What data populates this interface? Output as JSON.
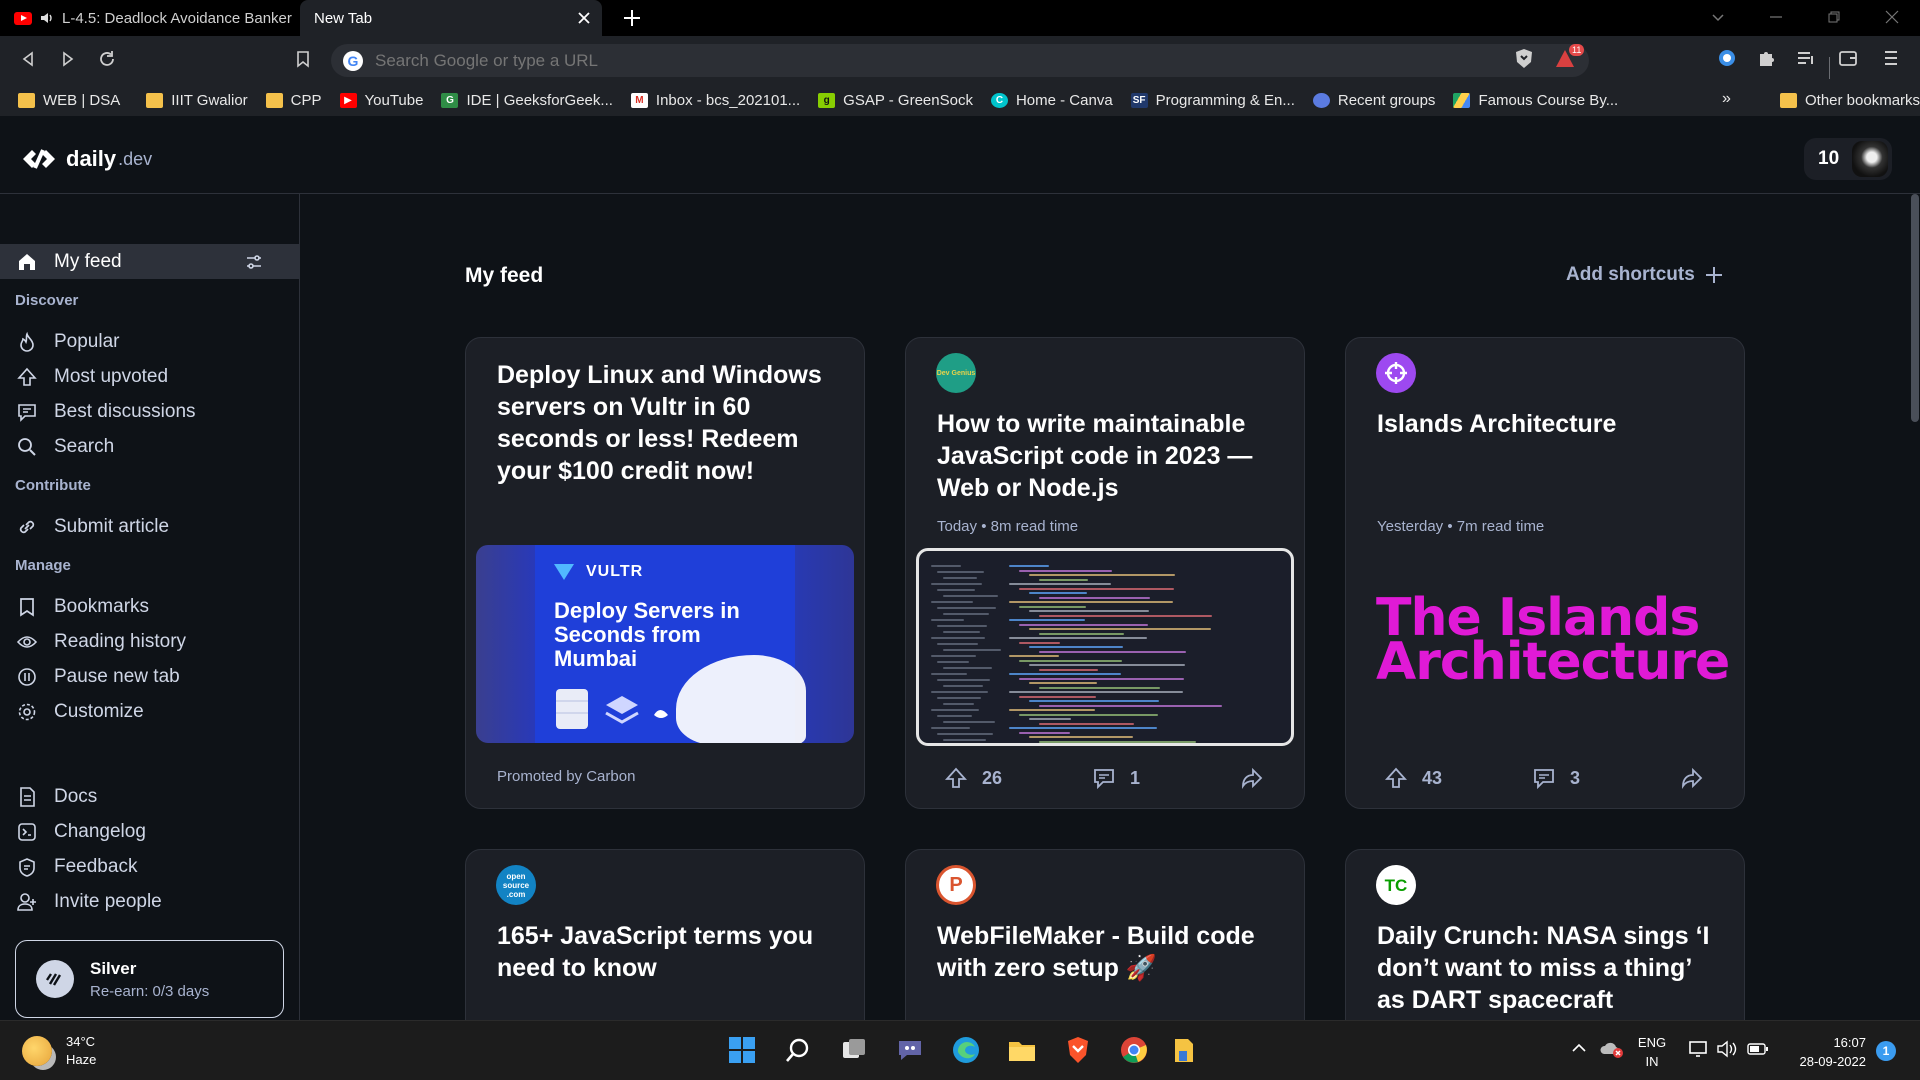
{
  "browser": {
    "tabs": [
      {
        "title": "L-4.5: Deadlock Avoidance Banker",
        "active": false
      },
      {
        "title": "New Tab",
        "active": true
      }
    ],
    "omnibox_placeholder": "Search Google or type a URL",
    "shields_badge": "11"
  },
  "bookmarks": [
    {
      "label": "WEB | DSA",
      "icon": "folder-icon"
    },
    {
      "label": "IIIT Gwalior",
      "icon": "folder-icon"
    },
    {
      "label": "CPP",
      "icon": "folder-icon"
    },
    {
      "label": "YouTube",
      "icon": "youtube-icon"
    },
    {
      "label": "IDE | GeeksforGeek...",
      "icon": "gfg-icon"
    },
    {
      "label": "Inbox - bcs_202101...",
      "icon": "gmail-icon"
    },
    {
      "label": "GSAP - GreenSock",
      "icon": "gsap-icon"
    },
    {
      "label": "Home - Canva",
      "icon": "canva-icon"
    },
    {
      "label": "Programming & En...",
      "icon": "sf-icon"
    },
    {
      "label": "Recent groups",
      "icon": "groups-icon"
    },
    {
      "label": "Famous Course By...",
      "icon": "drive-icon"
    }
  ],
  "bookmarks_more": "»",
  "bookmarks_other": "Other bookmarks",
  "app": {
    "logo_main": "daily",
    "logo_suffix": ".dev",
    "reputation": "10"
  },
  "sidebar": {
    "my_feed": "My feed",
    "discover_label": "Discover",
    "discover": [
      "Popular",
      "Most upvoted",
      "Best discussions",
      "Search"
    ],
    "contribute_label": "Contribute",
    "contribute": [
      "Submit article"
    ],
    "manage_label": "Manage",
    "manage": [
      "Bookmarks",
      "Reading history",
      "Pause new tab",
      "Customize"
    ],
    "bottom": [
      "Docs",
      "Changelog",
      "Feedback",
      "Invite people"
    ],
    "streak": {
      "title": "Silver",
      "subtitle": "Re-earn: 0/3 days"
    }
  },
  "feed": {
    "title": "My feed",
    "add_shortcuts": "Add shortcuts",
    "cards": [
      {
        "title": "Deploy Linux and Windows servers on Vultr in 60 seconds or less! Redeem your $100 credit now!",
        "footer": "Promoted by Carbon",
        "ad": {
          "brand": "VULTR",
          "headline": "Deploy Servers in Seconds from Mumbai"
        }
      },
      {
        "source": "Dev Genius",
        "title": "How to write maintainable JavaScript code in 2023 — Web or Node.js",
        "meta": "Today • 8m read time",
        "upvotes": "26",
        "comments": "1"
      },
      {
        "title": "Islands Architecture",
        "meta": "Yesterday • 7m read time",
        "image_text": [
          "The Islands",
          "Architecture"
        ],
        "upvotes": "43",
        "comments": "3"
      },
      {
        "source": "open source .com",
        "title": "165+ JavaScript terms you need to know"
      },
      {
        "source": "P",
        "title": "WebFileMaker - Build code with zero setup 🚀"
      },
      {
        "source": "TC",
        "title": "Daily Crunch: NASA sings ‘I don’t want to miss a thing’ as DART spacecraft strikes..."
      }
    ]
  },
  "taskbar": {
    "weather_temp": "34°C",
    "weather_desc": "Haze",
    "lang": "ENG",
    "region": "IN",
    "time": "16:07",
    "date": "28-09-2022",
    "notifications": "1"
  },
  "colors": {
    "app_bg": "#0e1217",
    "card_bg": "#1c1f26",
    "islands_magenta": "#e01ad6",
    "vultr_blue": "#1f3fd9"
  }
}
